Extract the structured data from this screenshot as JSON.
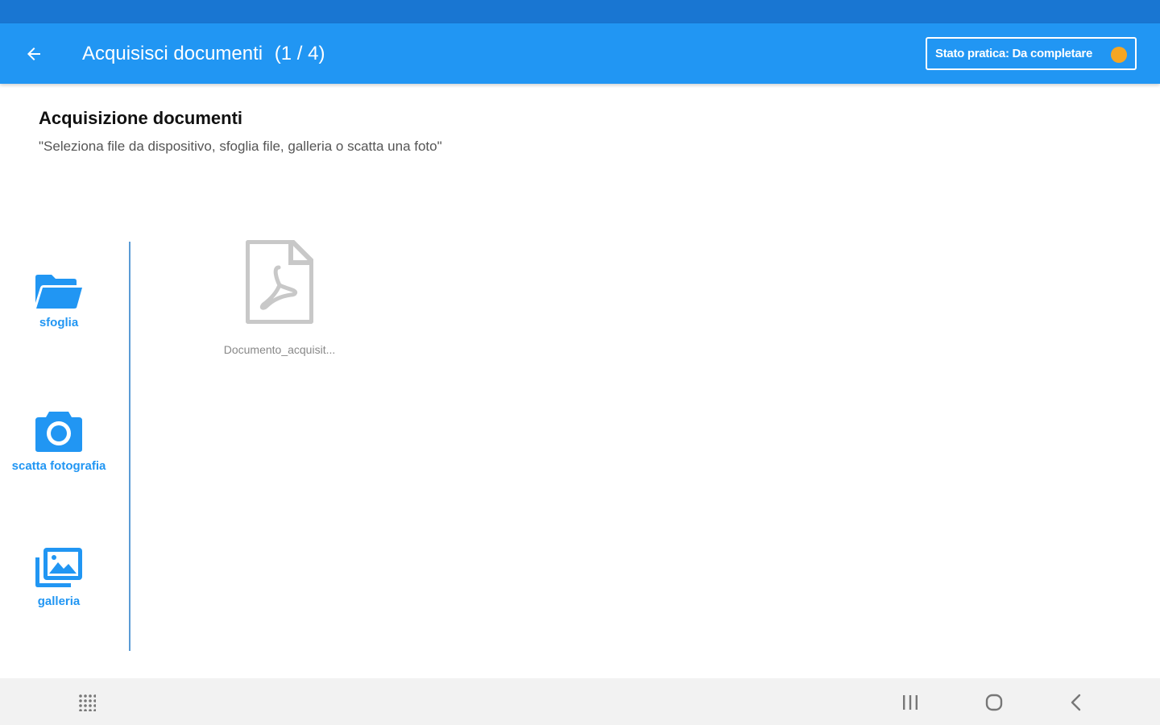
{
  "header": {
    "title": "Acquisisci documenti",
    "counter": "(1 / 4)",
    "status_label": "Stato pratica: Da completare",
    "status_color": "#f5a623",
    "back_icon": "arrow-left-icon"
  },
  "content": {
    "title": "Acquisizione documenti",
    "subtitle": "\"Seleziona file da dispositivo, sfoglia file, galleria o scatta una foto\""
  },
  "actions": [
    {
      "label": "sfoglia",
      "icon": "folder-open-icon"
    },
    {
      "label": "scatta fotografia",
      "icon": "camera-icon"
    },
    {
      "label": "galleria",
      "icon": "gallery-icon"
    }
  ],
  "documents": [
    {
      "name": "Documento_acquisit...",
      "icon": "pdf-file-icon"
    }
  ],
  "colors": {
    "primary": "#2196f3",
    "status_bar": "#1976d2",
    "divider": "#5b9bd5"
  }
}
